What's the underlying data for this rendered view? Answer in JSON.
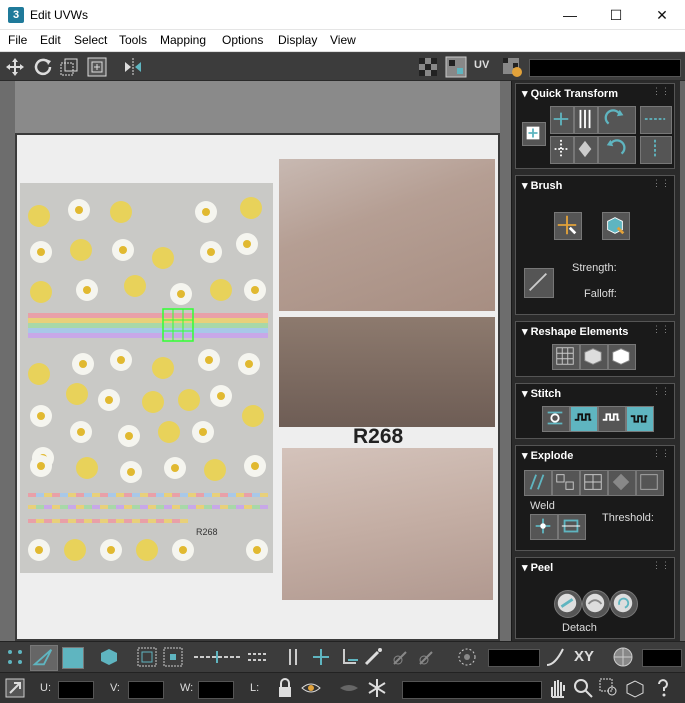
{
  "window": {
    "title": "Edit UVWs",
    "app_icon": "3",
    "minimize": "—",
    "maximize": "☐",
    "close": "✕"
  },
  "menu": [
    "File",
    "Edit",
    "Select",
    "Tools",
    "Mapping",
    "Options",
    "Display",
    "View"
  ],
  "toolbar": {
    "uv_label": "UV"
  },
  "viewport": {
    "label_text": "R268"
  },
  "rollouts": {
    "quick_transform": {
      "title": "Quick Transform"
    },
    "brush": {
      "title": "Brush",
      "strength_label": "Strength:",
      "falloff_label": "Falloff:"
    },
    "reshape": {
      "title": "Reshape Elements"
    },
    "stitch": {
      "title": "Stitch"
    },
    "explode": {
      "title": "Explode",
      "weld_label": "Weld",
      "threshold_label": "Threshold:"
    },
    "peel": {
      "title": "Peel",
      "detach_label": "Detach"
    }
  },
  "status": {
    "xy_label": "XY",
    "u_label": "U:",
    "v_label": "V:",
    "w_label": "W:",
    "l_label": "L:"
  },
  "colors": {
    "accent_teal": "#5fb5c0",
    "panel_bg": "#1a1a1a",
    "toolbar_bg": "#3c3c3c"
  }
}
